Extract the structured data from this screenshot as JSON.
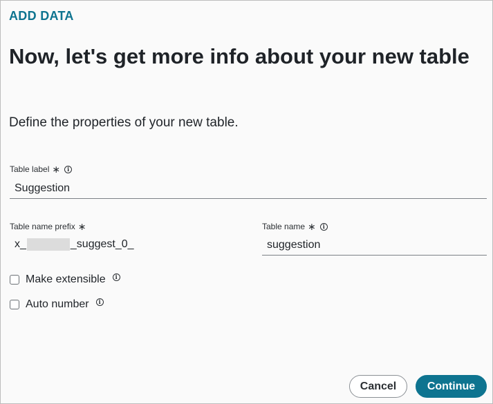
{
  "header": {
    "eyebrow": "ADD DATA",
    "title": "Now, let's get more info about your new table",
    "subtitle": "Define the properties of your new table."
  },
  "fields": {
    "table_label": {
      "label": "Table label",
      "required": "∗",
      "value": "Suggestion"
    },
    "table_name_prefix": {
      "label": "Table name prefix",
      "required": "∗",
      "prefix_start": "x_",
      "prefix_end": "_suggest_0_"
    },
    "table_name": {
      "label": "Table name",
      "required": "∗",
      "value": "suggestion"
    }
  },
  "options": {
    "make_extensible": {
      "label": "Make extensible",
      "checked": false
    },
    "auto_number": {
      "label": "Auto number",
      "checked": false
    }
  },
  "footer": {
    "cancel_label": "Cancel",
    "continue_label": "Continue"
  },
  "colors": {
    "accent": "#0e7490"
  },
  "icons": {
    "info": "info-icon",
    "required": "asterisk-icon"
  }
}
